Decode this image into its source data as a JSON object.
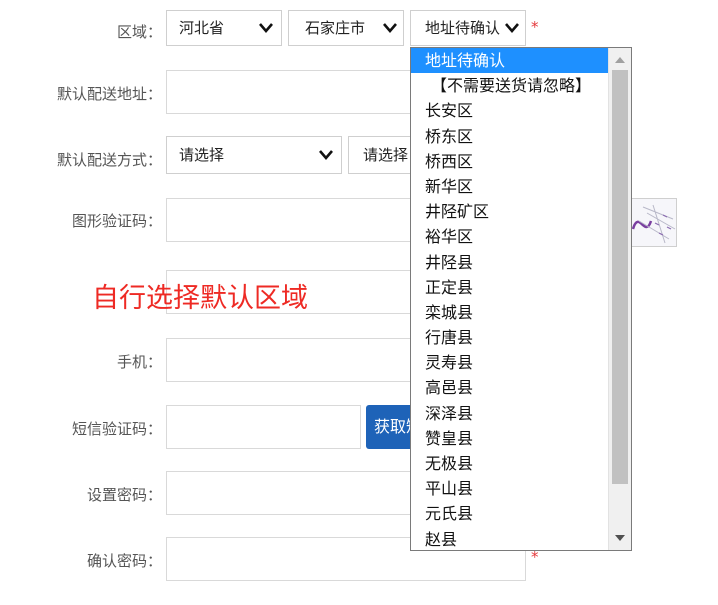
{
  "form": {
    "region": {
      "label": "区域：",
      "province": "河北省",
      "city": "石家庄市",
      "district": "地址待确认",
      "required_mark": "*"
    },
    "default_address": {
      "label": "默认配送地址："
    },
    "default_delivery": {
      "label": "默认配送方式：",
      "select1": "请选择",
      "select2": "请选择"
    },
    "captcha": {
      "label": "图形验证码："
    },
    "phone": {
      "label": "手机："
    },
    "sms_code": {
      "label": "短信验证码：",
      "get_button": "获取短信验证码"
    },
    "set_password": {
      "label": "设置密码："
    },
    "confirm_password": {
      "label": "确认密码：",
      "required_mark": "*"
    }
  },
  "annotation": "自行选择默认区域",
  "district_dropdown": {
    "options": [
      "地址待确认",
      "【不需要送货请忽略】",
      "长安区",
      "桥东区",
      "桥西区",
      "新华区",
      "井陉矿区",
      "裕华区",
      "井陉县",
      "正定县",
      "栾城县",
      "行唐县",
      "灵寿县",
      "高邑县",
      "深泽县",
      "赞皇县",
      "无极县",
      "平山县",
      "元氏县",
      "赵县"
    ],
    "selected_index": 0
  },
  "colors": {
    "accent": "#1e90ff",
    "button": "#1e63b8",
    "annotation": "#ee2a24",
    "required": "#e4393c"
  }
}
